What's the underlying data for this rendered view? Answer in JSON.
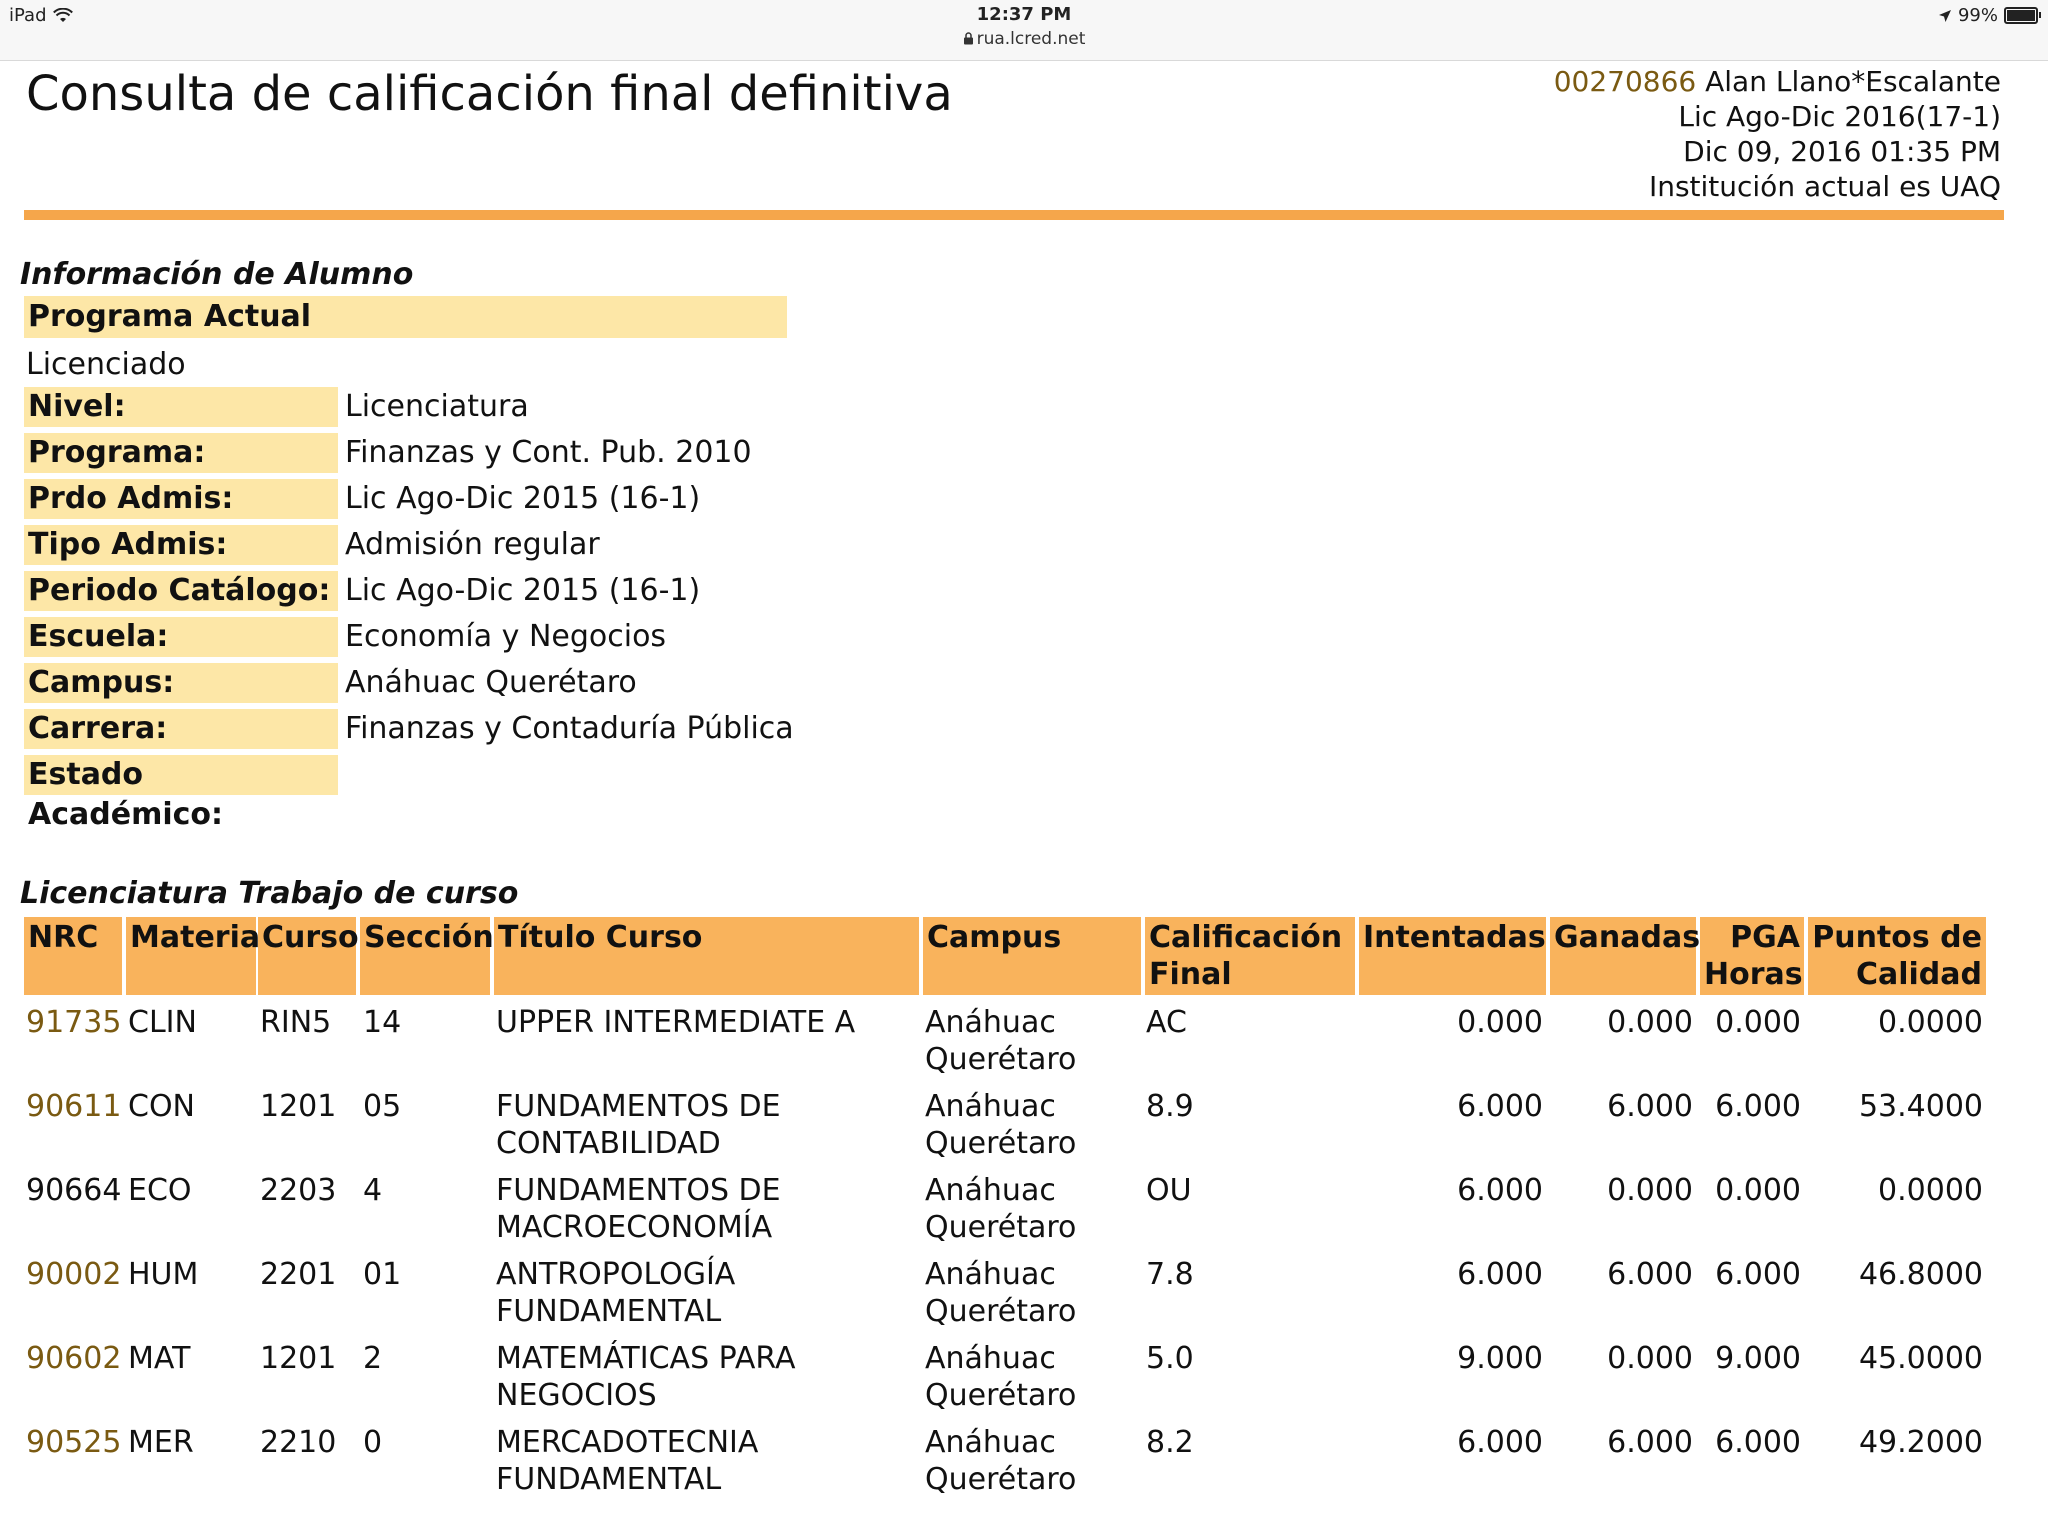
{
  "status_bar": {
    "device": "iPad",
    "time": "12:37 PM",
    "url": "rua.lcred.net",
    "battery": "99%"
  },
  "page": {
    "title": "Consulta de calificación final definitiva"
  },
  "user": {
    "id": "00270866",
    "name": "Alan Llano*Escalante",
    "term": "Lic Ago-Dic 2016(17-1)",
    "datetime": "Dic 09, 2016 01:35 PM",
    "institution": "Institución actual es UAQ"
  },
  "student_info": {
    "section_title": "Información de Alumno",
    "program_header": "Programa Actual",
    "program_value": "Licenciado",
    "fields": [
      {
        "label": "Nivel:",
        "value": "Licenciatura"
      },
      {
        "label": "Programa:",
        "value": "Finanzas y Cont. Pub. 2010"
      },
      {
        "label": "Prdo Admis:",
        "value": "Lic Ago-Dic 2015 (16-1)"
      },
      {
        "label": "Tipo Admis:",
        "value": "Admisión regular"
      },
      {
        "label": "Periodo Catálogo:",
        "value": "Lic Ago-Dic 2015 (16-1)"
      },
      {
        "label": "Escuela:",
        "value": "Economía y Negocios"
      },
      {
        "label": "Campus:",
        "value": "Anáhuac Querétaro"
      },
      {
        "label": "Carrera:",
        "value": "Finanzas y Contaduría Pública"
      },
      {
        "label": "Estado Académico:",
        "value": ""
      }
    ]
  },
  "coursework": {
    "section_title": "Licenciatura Trabajo de curso",
    "headers": {
      "nrc": "NRC",
      "materia": "Materia",
      "curso": "Curso",
      "seccion": "Sección",
      "titulo": "Título Curso",
      "campus": "Campus",
      "calificacion_l1": "Calificación",
      "calificacion_l2": "Final",
      "intentadas": "Intentadas",
      "ganadas": "Ganadas",
      "pga_l1": "PGA",
      "pga_l2": "Horas",
      "puntos_l1": "Puntos de",
      "puntos_l2": "Calidad"
    },
    "rows": [
      {
        "nrc": "91735",
        "nrc_link": true,
        "materia": "CLIN",
        "curso": "RIN5",
        "seccion": "14",
        "titulo_l1": "UPPER INTERMEDIATE A",
        "titulo_l2": "",
        "campus_l1": "Anáhuac",
        "campus_l2": "Querétaro",
        "calificacion": "AC",
        "intentadas": "0.000",
        "ganadas": "0.000",
        "pga": "0.000",
        "puntos": "0.0000"
      },
      {
        "nrc": "90611",
        "nrc_link": true,
        "materia": "CON",
        "curso": "1201",
        "seccion": "05",
        "titulo_l1": "FUNDAMENTOS DE",
        "titulo_l2": "CONTABILIDAD",
        "campus_l1": "Anáhuac",
        "campus_l2": "Querétaro",
        "calificacion": "8.9",
        "intentadas": "6.000",
        "ganadas": "6.000",
        "pga": "6.000",
        "puntos": "53.4000"
      },
      {
        "nrc": "90664",
        "nrc_link": false,
        "materia": "ECO",
        "curso": "2203",
        "seccion": "4",
        "titulo_l1": "FUNDAMENTOS DE",
        "titulo_l2": "MACROECONOMÍA",
        "campus_l1": "Anáhuac",
        "campus_l2": "Querétaro",
        "calificacion": "OU",
        "intentadas": "6.000",
        "ganadas": "0.000",
        "pga": "0.000",
        "puntos": "0.0000"
      },
      {
        "nrc": "90002",
        "nrc_link": true,
        "materia": "HUM",
        "curso": "2201",
        "seccion": "01",
        "titulo_l1": "ANTROPOLOGÍA",
        "titulo_l2": "FUNDAMENTAL",
        "campus_l1": "Anáhuac",
        "campus_l2": "Querétaro",
        "calificacion": "7.8",
        "intentadas": "6.000",
        "ganadas": "6.000",
        "pga": "6.000",
        "puntos": "46.8000"
      },
      {
        "nrc": "90602",
        "nrc_link": true,
        "materia": "MAT",
        "curso": "1201",
        "seccion": "2",
        "titulo_l1": "MATEMÁTICAS PARA",
        "titulo_l2": "NEGOCIOS",
        "campus_l1": "Anáhuac",
        "campus_l2": "Querétaro",
        "calificacion": "5.0",
        "intentadas": "9.000",
        "ganadas": "0.000",
        "pga": "9.000",
        "puntos": "45.0000"
      },
      {
        "nrc": "90525",
        "nrc_link": true,
        "materia": "MER",
        "curso": "2210",
        "seccion": "0",
        "titulo_l1": "MERCADOTECNIA",
        "titulo_l2": "FUNDAMENTAL",
        "campus_l1": "Anáhuac",
        "campus_l2": "Querétaro",
        "calificacion": "8.2",
        "intentadas": "6.000",
        "ganadas": "6.000",
        "pga": "6.000",
        "puntos": "49.2000"
      }
    ]
  },
  "colors": {
    "accent_rule": "#f5a64b",
    "label_bg": "#fde7a7",
    "table_header_bg": "#f9b35c",
    "link": "#7a5a12"
  }
}
